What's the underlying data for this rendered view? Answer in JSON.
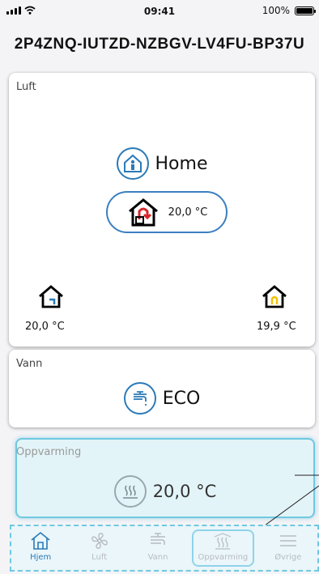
{
  "status_bar": {
    "time": "09:41",
    "battery": "100%"
  },
  "device_id": "2P4ZNQ-IUTZD-NZBGV-LV4FU-BP37U",
  "luft": {
    "label": "Luft",
    "mode": "Home",
    "supply_temp": "20,0 °C",
    "left_temp": "20,0 °C",
    "right_temp": "19,9 °C"
  },
  "vann": {
    "label": "Vann",
    "mode": "ECO"
  },
  "oppvarming": {
    "label": "Oppvarming",
    "temp": "20,0 °C"
  },
  "nav": {
    "home": "Hjem",
    "luft": "Luft",
    "vann": "Vann",
    "oppvarming": "Oppvarming",
    "ovrige": "Øvrige"
  },
  "colors": {
    "accent": "#2a7ab8",
    "highlight": "#6fc8e2",
    "red": "#d9252a",
    "yellow": "#f2c200"
  }
}
